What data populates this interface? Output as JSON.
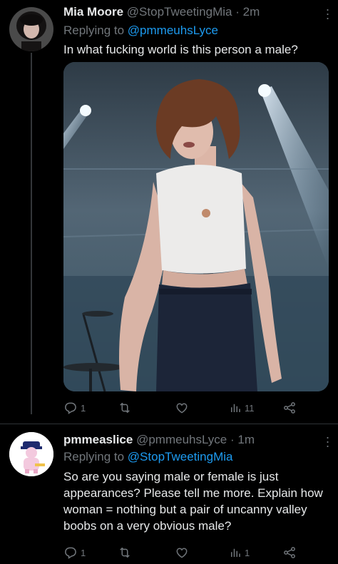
{
  "tweets": [
    {
      "name": "Mia Moore",
      "handle": "@StopTweetingMia",
      "time": "2m",
      "replying_prefix": "Replying to",
      "replying_handle": "@pmmeuhsLyce",
      "text": "In what fucking world is this person a male?",
      "replies": "1",
      "retweets": "",
      "likes": "",
      "views": "11"
    },
    {
      "name": "pmmeaslice",
      "handle": "@pmmeuhsLyce",
      "time": "1m",
      "replying_prefix": "Replying to",
      "replying_handle": "@StopTweetingMia",
      "text": "So are you saying male or female is just appearances? Please tell me more. Explain how woman = nothing but a pair of uncanny valley boobs on a very obvious male?",
      "replies": "1",
      "retweets": "",
      "likes": "",
      "views": "1"
    }
  ],
  "separator": "·",
  "colors": {
    "accent": "#1d9bf0",
    "muted": "#71767b",
    "text": "#e7e9ea",
    "background": "#000000"
  },
  "icons": [
    "more-icon",
    "reply-icon",
    "retweet-icon",
    "like-icon",
    "views-icon",
    "share-icon"
  ]
}
